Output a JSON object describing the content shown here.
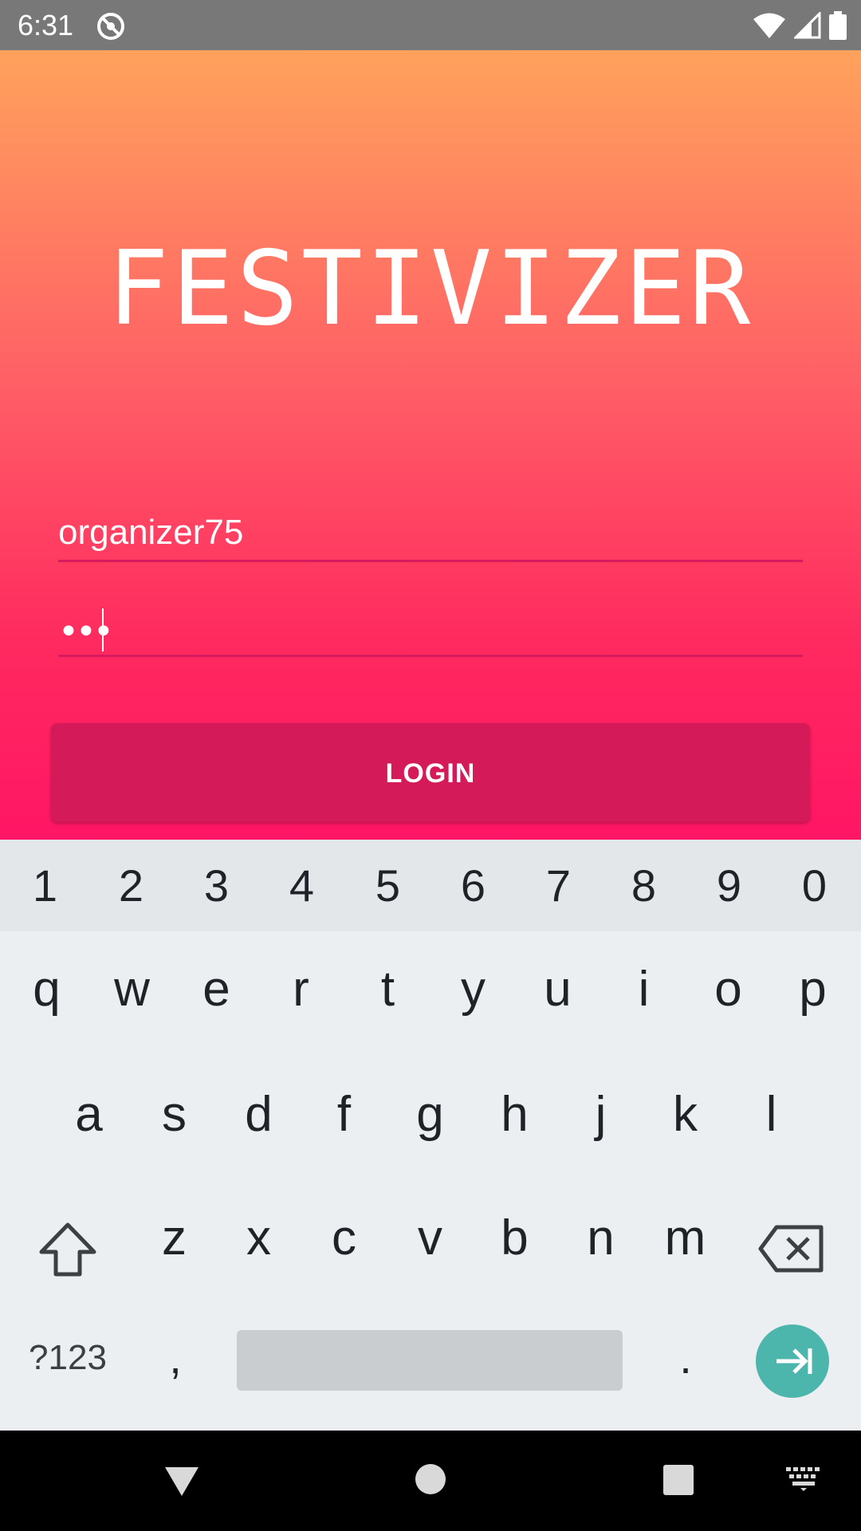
{
  "status_bar": {
    "time": "6:31",
    "icons": [
      "notification-icon",
      "wifi-icon",
      "signal-icon",
      "battery-icon"
    ]
  },
  "app": {
    "title": "FESTIVIZER",
    "username_value": "organizer75",
    "password_masked": "•••",
    "login_label": "LOGIN",
    "colors": {
      "gradient_top": "#ffa25c",
      "gradient_bottom": "#ff1565",
      "button": "#d41a58",
      "underline": "#d81a5f"
    }
  },
  "keyboard": {
    "numbers": [
      "1",
      "2",
      "3",
      "4",
      "5",
      "6",
      "7",
      "8",
      "9",
      "0"
    ],
    "row1": [
      "q",
      "w",
      "e",
      "r",
      "t",
      "y",
      "u",
      "i",
      "o",
      "p"
    ],
    "row2": [
      "a",
      "s",
      "d",
      "f",
      "g",
      "h",
      "j",
      "k",
      "l"
    ],
    "row3": [
      "z",
      "x",
      "c",
      "v",
      "b",
      "n",
      "m"
    ],
    "symbols_label": "?123",
    "comma": ",",
    "period": ".",
    "enter_color": "#4db6ac"
  },
  "nav_bar": {
    "icons": [
      "back-icon",
      "home-icon",
      "recents-icon",
      "keyboard-icon"
    ]
  }
}
